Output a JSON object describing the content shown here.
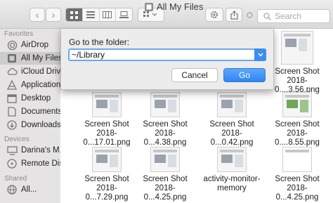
{
  "window": {
    "title": "All My Files"
  },
  "toolbar": {
    "back_label": "‹",
    "forward_label": "›",
    "search_placeholder": "Search"
  },
  "sidebar": {
    "favorites_heading": "Favorites",
    "favorites": [
      {
        "label": "AirDrop",
        "icon": "airdrop-icon"
      },
      {
        "label": "All My Files",
        "icon": "all-files-icon",
        "selected": true
      },
      {
        "label": "iCloud Drive",
        "icon": "cloud-icon"
      },
      {
        "label": "Applications",
        "icon": "applications-icon"
      },
      {
        "label": "Desktop",
        "icon": "desktop-icon"
      },
      {
        "label": "Documents",
        "icon": "documents-icon"
      },
      {
        "label": "Downloads",
        "icon": "downloads-icon"
      }
    ],
    "devices_heading": "Devices",
    "devices": [
      {
        "label": "Darina's M...",
        "icon": "computer-icon"
      },
      {
        "label": "Remote Disc",
        "icon": "disc-icon"
      }
    ],
    "shared_heading": "Shared",
    "shared": [
      {
        "label": "All...",
        "icon": "network-icon"
      }
    ]
  },
  "files": [
    {
      "line1": "Screen Shot",
      "line2": "2018-0....3.56.png"
    },
    {
      "line1": "Screen Shot",
      "line2": "2018-0...17.01.png"
    },
    {
      "line1": "Screen Shot",
      "line2": "2018-0...4.38.png"
    },
    {
      "line1": "Screen Shot",
      "line2": "2018-0...0.42.png"
    },
    {
      "line1": "Screen Shot",
      "line2": "2018-0....8.55.png"
    },
    {
      "line1": "Screen Shot",
      "line2": "2018-0...7.29.png"
    },
    {
      "line1": "Screen Shot",
      "line2": "2018-0...4.25.png"
    },
    {
      "line1": "activity-monitor-",
      "line2": "memory"
    },
    {
      "line1": "Screen Shot",
      "line2": "2018-0...4.25.png"
    }
  ],
  "dialog": {
    "label": "Go to the folder:",
    "path_value": "~/Library",
    "cancel_label": "Cancel",
    "go_label": "Go"
  }
}
